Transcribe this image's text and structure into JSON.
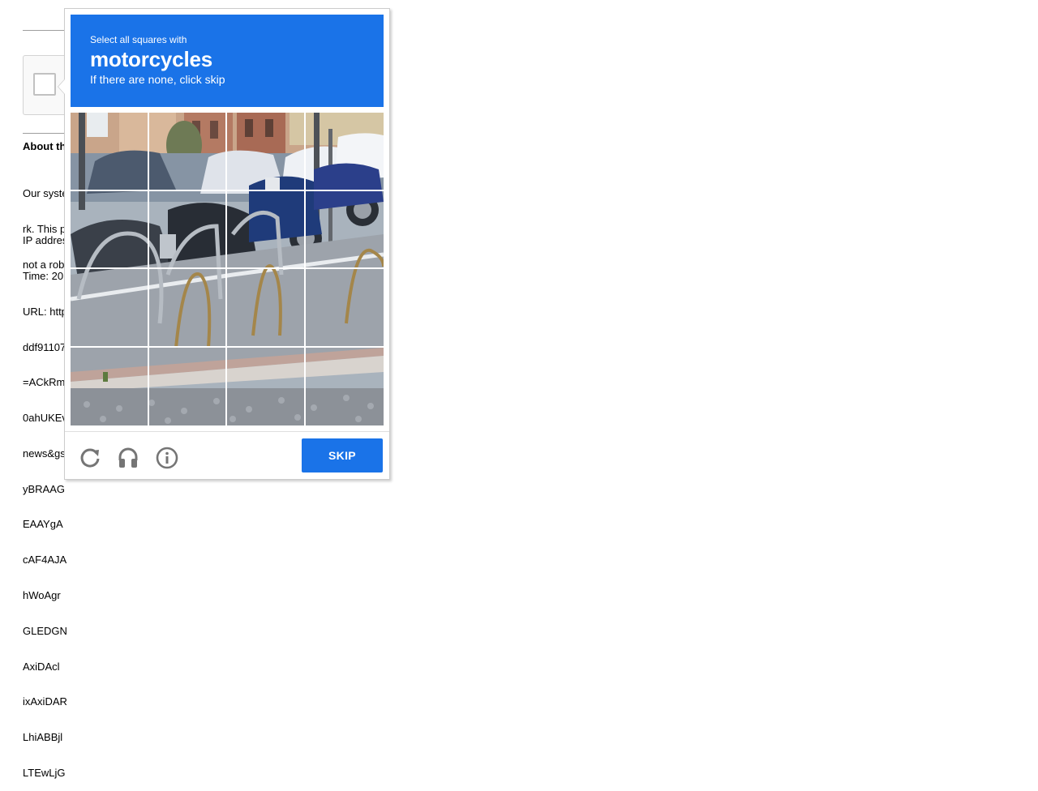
{
  "background": {
    "about_title": "About th",
    "paragraph1": [
      "Our syste",
      "rk. This p",
      "not a rob"
    ],
    "paragraph2": [
      "IP addres",
      "Time: 20",
      "URL: http",
      "ddf91107",
      "=ACkRm",
      "0ahUKEv",
      "news&gs",
      "yBRAAG",
      "EAAYgA",
      "cAF4AJA",
      "hWoAgr",
      "GLEDGN",
      "AxiDAcl",
      "ixAxiDAR",
      "LhiABBjl",
      "LTEwLjG"
    ]
  },
  "challenge": {
    "instruction": "Select all squares with",
    "target": "motorcycles",
    "subtext": "If there are none, click skip",
    "skip_label": "SKIP",
    "icons": [
      "reload-icon",
      "audio-challenge-icon",
      "info-icon"
    ],
    "grid": {
      "rows": 4,
      "cols": 4
    }
  },
  "colors": {
    "accent": "#1a73e8",
    "icon_gray": "#757575"
  }
}
